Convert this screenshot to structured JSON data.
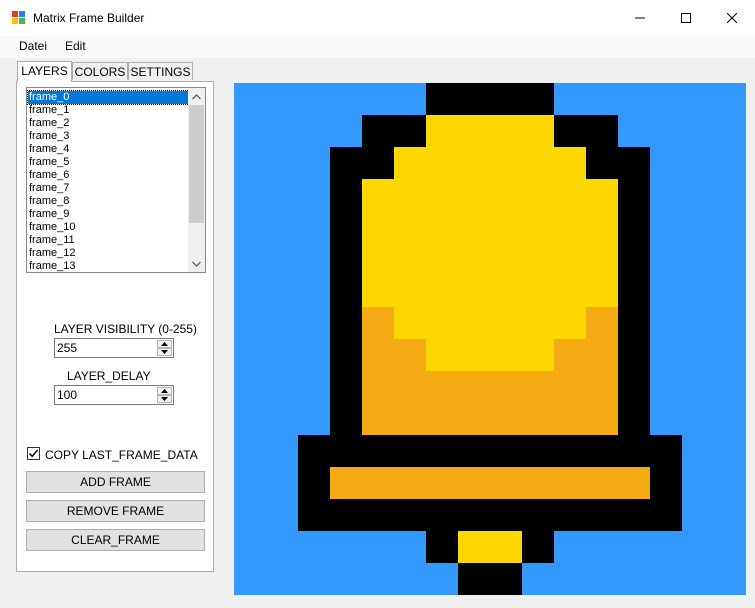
{
  "window": {
    "title": "Matrix Frame Builder",
    "minimize_symbol": "—",
    "maximize_symbol": "☐",
    "close_symbol": "✕"
  },
  "menu": [
    "Datei",
    "Edit"
  ],
  "tabs": [
    {
      "label": "LAYERS",
      "active": true
    },
    {
      "label": "COLORS",
      "active": false
    },
    {
      "label": "SETTINGS",
      "active": false
    }
  ],
  "frames": {
    "items": [
      "frame_0",
      "frame_1",
      "frame_2",
      "frame_3",
      "frame_4",
      "frame_5",
      "frame_6",
      "frame_7",
      "frame_8",
      "frame_9",
      "frame_10",
      "frame_11",
      "frame_12",
      "frame_13"
    ],
    "selected_index": 0
  },
  "layer_visibility": {
    "label": "LAYER VISIBILITY (0-255)",
    "value": "255"
  },
  "layer_delay": {
    "label": "LAYER_DELAY",
    "value": "100"
  },
  "copy_last": {
    "label": "COPY LAST_FRAME_DATA",
    "checked": true
  },
  "buttons": {
    "add": "ADD FRAME",
    "remove": "REMOVE FRAME",
    "clear": "CLEAR_FRAME"
  },
  "pixel_grid": {
    "palette": {
      "B": "#3399ff",
      "K": "#000000",
      "Y": "#ffd700",
      "O": "#f5ab14"
    },
    "rows": [
      "BBBBBBKKKKBBBBBB",
      "BBBBKKYYYYKKBBBB",
      "BBBKKYYYYYYKKBBB",
      "BBBKYYYYYYYYKBBB",
      "BBBKYYYYYYYYKBBB",
      "BBBKYYYYYYYYKBBB",
      "BBBKYYYYYYYYKBBB",
      "BBBKOYYYYYYOKBBB",
      "BBBKOOYYYYOOKBBB",
      "BBBKOOOOOOOOKBBB",
      "BBBKOOOOOOOOKBBB",
      "BBKKKKKKKKKKKKBB",
      "BBKOOOOOOOOOOKBB",
      "BBKKKKKKKKKKKKBB",
      "BBBBBBKYYKBBBBBB",
      "BBBBBBBKKBBBBBBB"
    ]
  }
}
